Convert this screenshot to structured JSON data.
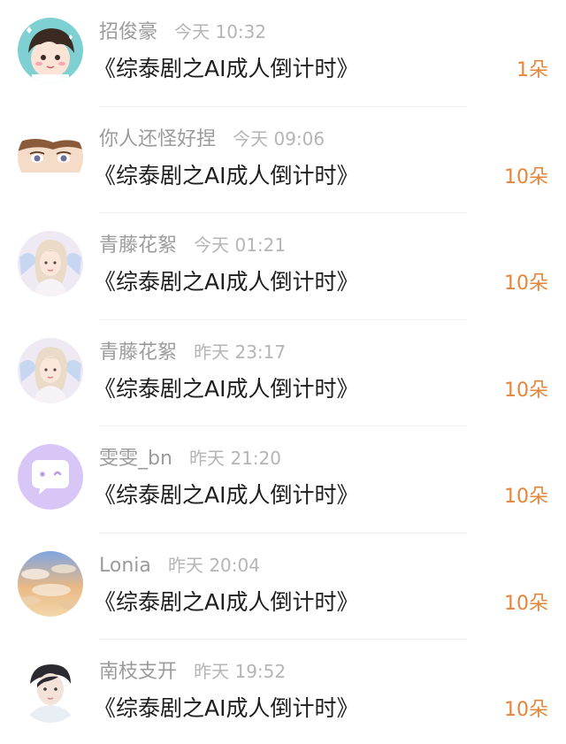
{
  "items": [
    {
      "name": "招俊豪",
      "time": "今天 10:32",
      "title": "《综泰剧之AI成人倒计时》",
      "count": "1朵",
      "avatar": "cartoon-boy-avatar"
    },
    {
      "name": "你人还怪好捏",
      "time": "今天 09:06",
      "title": "《综泰剧之AI成人倒计时》",
      "count": "10朵",
      "avatar": "anime-eyes-avatar"
    },
    {
      "name": "青藤花絮",
      "time": "今天 01:21",
      "title": "《综泰剧之AI成人倒计时》",
      "count": "10朵",
      "avatar": "angel-portrait-avatar"
    },
    {
      "name": "青藤花絮",
      "time": "昨天 23:17",
      "title": "《综泰剧之AI成人倒计时》",
      "count": "10朵",
      "avatar": "angel-portrait-avatar"
    },
    {
      "name": "雯雯_bn",
      "time": "昨天 21:20",
      "title": "《综泰剧之AI成人倒计时》",
      "count": "10朵",
      "avatar": "chat-bubble-avatar"
    },
    {
      "name": "Lonia",
      "time": "昨天 20:04",
      "title": "《综泰剧之AI成人倒计时》",
      "count": "10朵",
      "avatar": "sky-clouds-avatar"
    },
    {
      "name": "南枝支开",
      "time": "昨天 19:52",
      "title": "《综泰剧之AI成人倒计时》",
      "count": "10朵",
      "avatar": "portrait-avatar"
    }
  ],
  "colors": {
    "name": "#9b9b9b",
    "time": "#b5b5b5",
    "title": "#1e1e1e",
    "count": "#e3863a"
  }
}
